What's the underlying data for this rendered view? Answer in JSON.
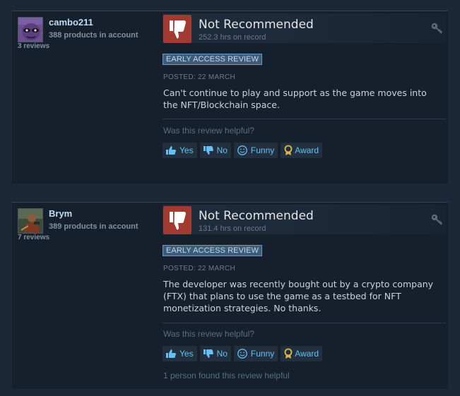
{
  "reviews": [
    {
      "author": {
        "name": "cambo211",
        "products": "388 products in account",
        "reviews": "3 reviews"
      },
      "recommendation": "Not Recommended",
      "hours": "252.3 hrs on record",
      "badge": "EARLY ACCESS REVIEW",
      "posted": "POSTED: 22 MARCH",
      "body": "Can't continue to play and support as the game moves into the NFT/Blockchain space.",
      "helpful_question": "Was this review helpful?",
      "buttons": {
        "yes": "Yes",
        "no": "No",
        "funny": "Funny",
        "award": "Award"
      }
    },
    {
      "author": {
        "name": "Brym",
        "products": "389 products in account",
        "reviews": "7 reviews"
      },
      "recommendation": "Not Recommended",
      "hours": "131.4 hrs on record",
      "badge": "EARLY ACCESS REVIEW",
      "posted": "POSTED: 22 MARCH",
      "body": "The developer was recently bought out by a crypto company (FTX) that plans to use the game as a testbed for NFT monetization strategies. No thanks.",
      "helpful_question": "Was this review helpful?",
      "buttons": {
        "yes": "Yes",
        "no": "No",
        "funny": "Funny",
        "award": "Award"
      },
      "found_helpful": "1 person found this review helpful"
    }
  ],
  "colors": {
    "thumb_down_bg": "#a33a31",
    "link": "#66c0f4",
    "badge_bg": "#3e5b7a"
  },
  "icons": [
    "thumbs-down-icon",
    "key-icon",
    "thumbs-up-icon",
    "smiley-icon",
    "award-icon"
  ]
}
